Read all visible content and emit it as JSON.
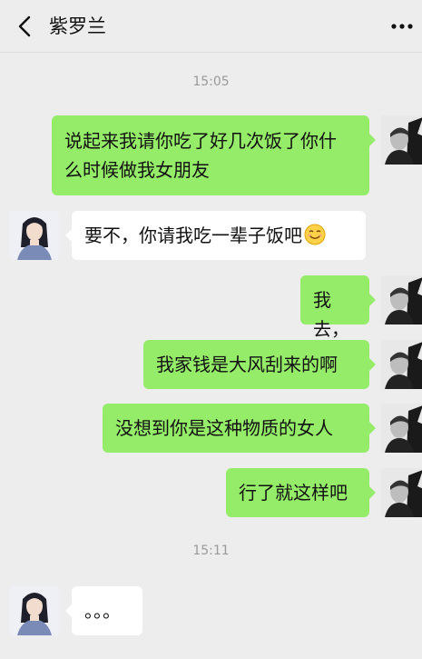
{
  "header": {
    "title": "紫罗兰",
    "back_icon": "chevron-left-icon",
    "more_icon": "more-dots-icon"
  },
  "colors": {
    "background": "#ededed",
    "my_bubble": "#95ec69",
    "their_bubble": "#ffffff",
    "timestamp": "#9a9a9a"
  },
  "messages": {
    "time1": "15:05",
    "m1": "说起来我请你吃了好几次饭了你什\n么时候做我女朋友",
    "m2": "要不，你请我吃一辈子饭吧",
    "m2_emoji": "smiling-face-emoji",
    "m3": "我去，",
    "m4": "我家钱是大风刮来的啊",
    "m5": "没想到你是这种物质的女人",
    "m6": "行了就这样吧",
    "time2": "15:11",
    "m7": "。。。"
  }
}
